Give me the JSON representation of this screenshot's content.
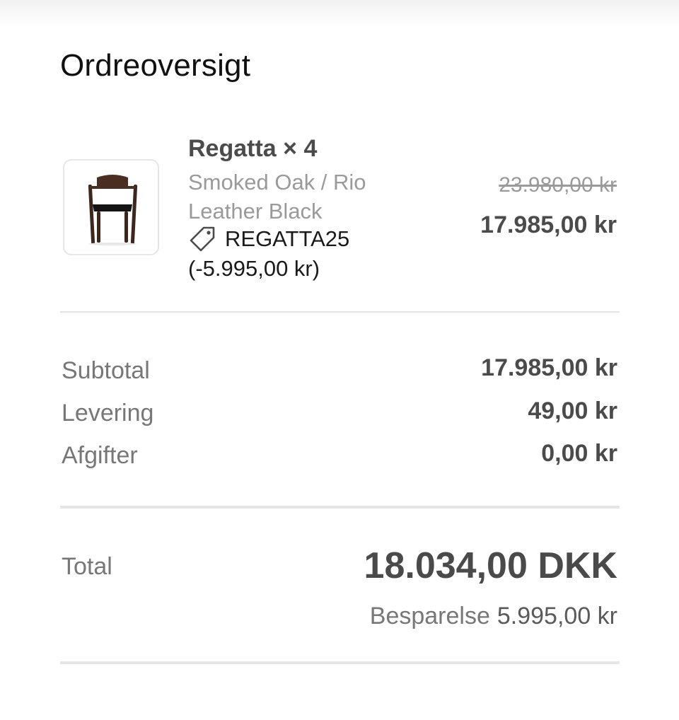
{
  "header": {
    "title": "Ordreoversigt"
  },
  "line_item": {
    "image_icon": "chair-product-image",
    "name": "Regatta × 4",
    "variant": "Smoked Oak / Rio Leather Black",
    "discount_code_icon": "tag-icon",
    "discount_code": "REGATTA25",
    "discount_amount": "(-5.995,00 kr)",
    "original_price": "23.980,00 kr",
    "price": "17.985,00 kr"
  },
  "summary": {
    "rows": [
      {
        "label": "Subtotal",
        "value": "17.985,00 kr"
      },
      {
        "label": "Levering",
        "value": "49,00 kr"
      },
      {
        "label": "Afgifter",
        "value": "0,00 kr"
      }
    ]
  },
  "total": {
    "label": "Total",
    "value": "18.034,00 DKK",
    "savings_label": "Besparelse",
    "savings_value": "5.995,00 kr"
  },
  "colors": {
    "text_dark": "#111111",
    "text_strong": "#4b4b4b",
    "text_muted": "#9a9a9a",
    "divider": "#e3e3e3"
  }
}
